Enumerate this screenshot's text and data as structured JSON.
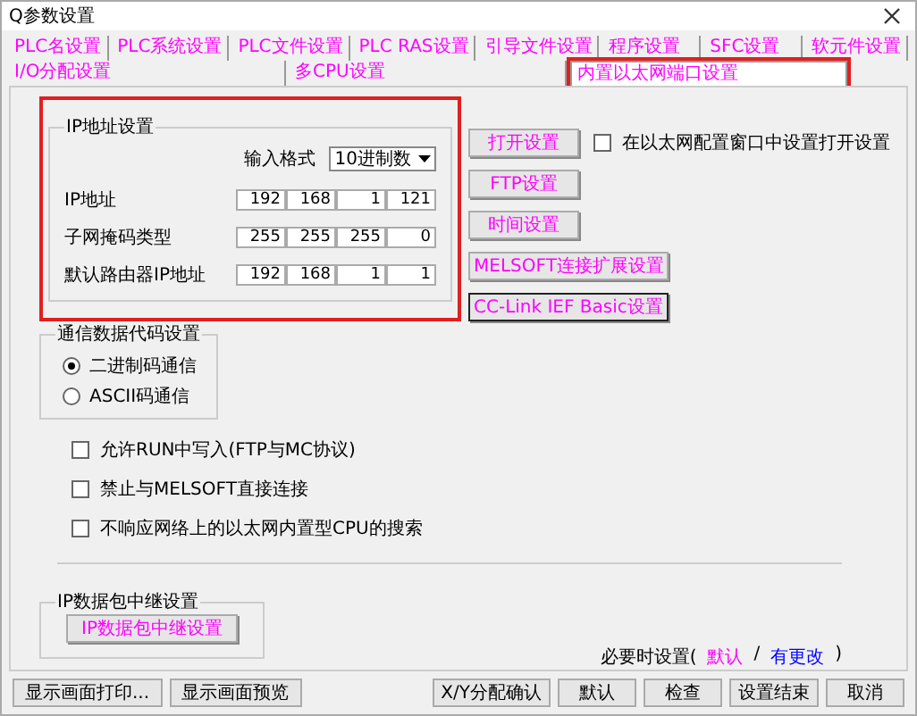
{
  "window": {
    "title": "Q参数设置"
  },
  "tabs": [
    [
      {
        "label": "PLC名设置",
        "selected": false,
        "highlighted": false
      },
      {
        "label": "PLC系统设置",
        "selected": false,
        "highlighted": false
      },
      {
        "label": "PLC文件设置",
        "selected": false,
        "highlighted": false
      },
      {
        "label": "PLC RAS设置",
        "selected": false,
        "highlighted": false
      },
      {
        "label": "引导文件设置",
        "selected": false,
        "highlighted": false
      },
      {
        "label": "程序设置",
        "selected": false,
        "highlighted": false
      },
      {
        "label": "SFC设置",
        "selected": false,
        "highlighted": false
      },
      {
        "label": "软元件设置",
        "selected": false,
        "highlighted": false
      }
    ],
    [
      {
        "label": "I/O分配设置",
        "selected": false,
        "highlighted": false
      },
      {
        "label": "多CPU设置",
        "selected": false,
        "highlighted": false
      },
      {
        "label": "内置以太网端口设置",
        "selected": true,
        "highlighted": true
      }
    ]
  ],
  "ip_settings": {
    "title": "IP地址设置",
    "highlighted": true,
    "format_label": "输入格式",
    "format_value": "10进制数",
    "rows": [
      {
        "label": "IP地址",
        "octets": [
          "192",
          "168",
          "1",
          "121"
        ]
      },
      {
        "label": "子网掩码类型",
        "octets": [
          "255",
          "255",
          "255",
          "0"
        ]
      },
      {
        "label": "默认路由器IP地址",
        "octets": [
          "192",
          "168",
          "1",
          "1"
        ]
      }
    ]
  },
  "side_buttons": [
    {
      "label": "打开设置",
      "focused": false
    },
    {
      "label": "FTP设置",
      "focused": false
    },
    {
      "label": "时间设置",
      "focused": false
    },
    {
      "label": "MELSOFT连接扩展设置",
      "focused": false
    },
    {
      "label": "CC-Link IEF Basic设置",
      "focused": true
    }
  ],
  "open_setting_checkbox": {
    "label": "在以太网配置窗口中设置打开设置",
    "checked": false
  },
  "code_settings": {
    "title": "通信数据代码设置",
    "options": [
      {
        "label": "二进制码通信",
        "selected": true
      },
      {
        "label": "ASCII码通信",
        "selected": false
      }
    ]
  },
  "options": [
    {
      "label": "允许RUN中写入(FTP与MC协议)",
      "checked": false
    },
    {
      "label": "禁止与MELSOFT直接连接",
      "checked": false
    },
    {
      "label": "不响应网络上的以太网内置型CPU的搜索",
      "checked": false
    }
  ],
  "relay": {
    "title": "IP数据包中继设置",
    "button": "IP数据包中继设置"
  },
  "legend": {
    "prefix": "必要时设置(",
    "default": "默认",
    "separator": "/",
    "changed": "有更改",
    "suffix": ")"
  },
  "footer_left": [
    "显示画面打印...",
    "显示画面预览"
  ],
  "footer_right": [
    "X/Y分配确认",
    "默认",
    "检查",
    "设置结束",
    "取消"
  ]
}
